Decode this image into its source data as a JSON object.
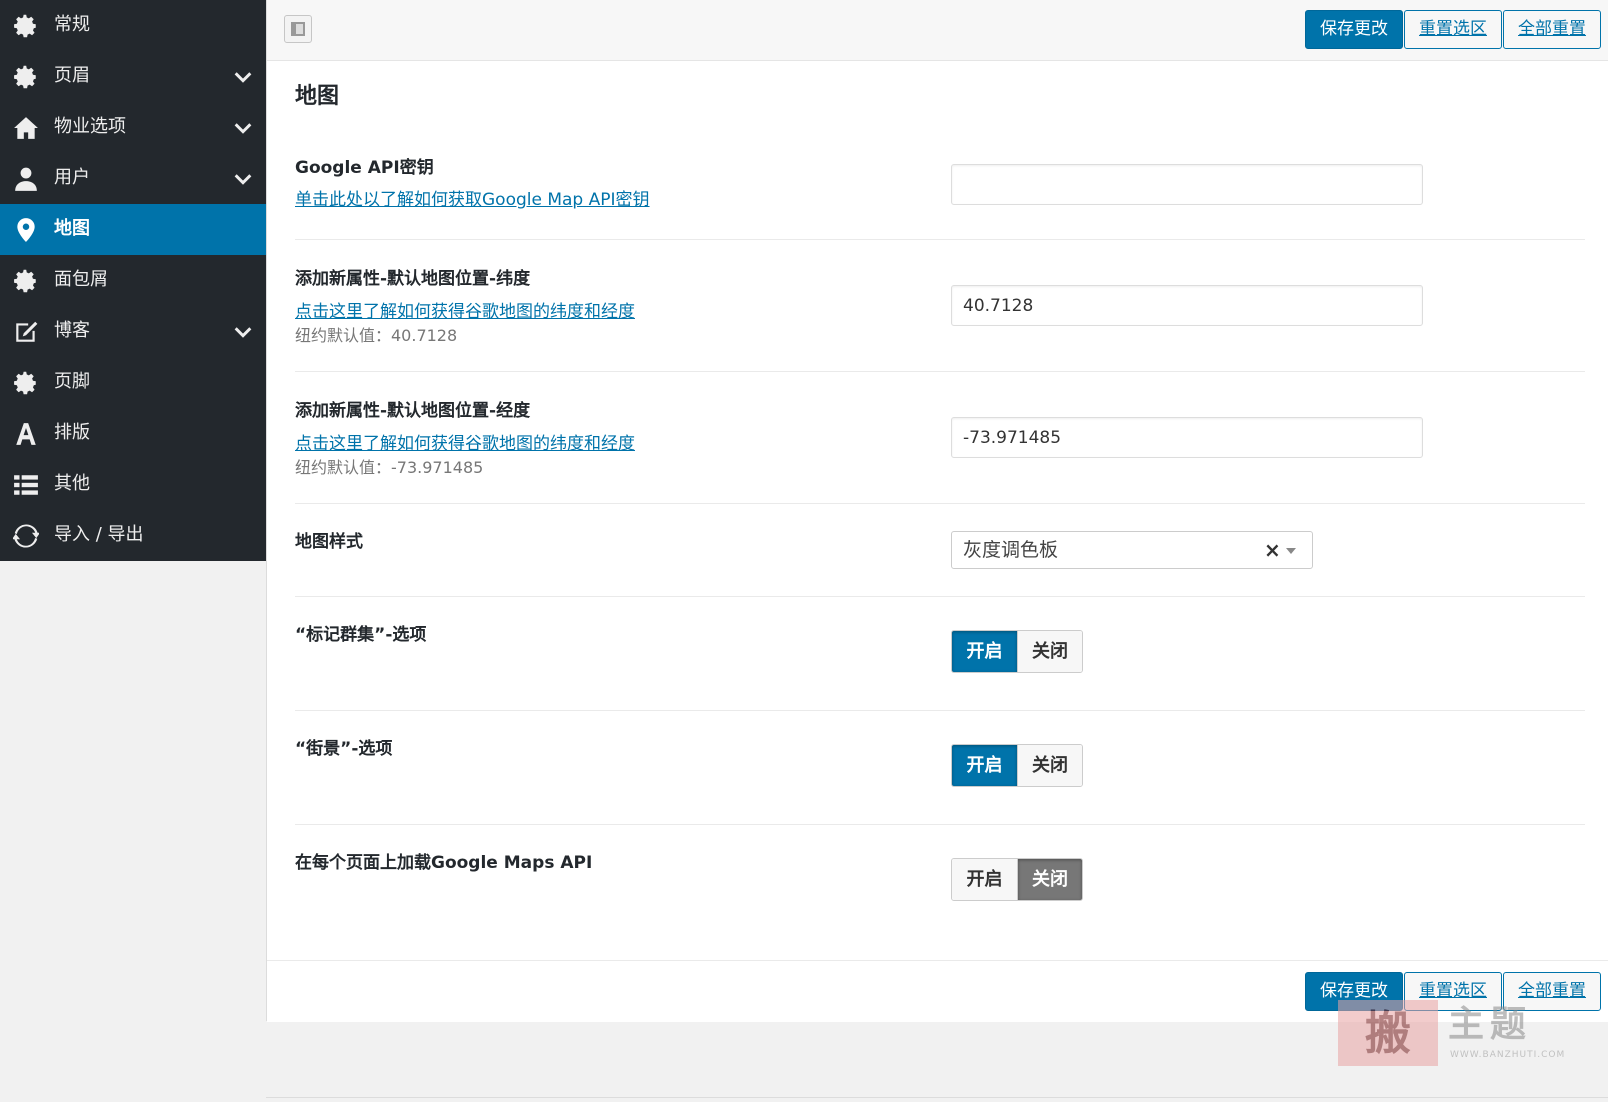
{
  "sidebar": {
    "items": [
      {
        "label": "常规",
        "icon": "gear-icon"
      },
      {
        "label": "页眉",
        "icon": "gear-icon",
        "has_children": true
      },
      {
        "label": "物业选项",
        "icon": "home-icon",
        "has_children": true
      },
      {
        "label": "用户",
        "icon": "user-icon",
        "has_children": true
      },
      {
        "label": "地图",
        "icon": "map-pin-icon",
        "active": true
      },
      {
        "label": "面包屑",
        "icon": "gear-icon"
      },
      {
        "label": "博客",
        "icon": "edit-icon",
        "has_children": true
      },
      {
        "label": "页脚",
        "icon": "gear-icon"
      },
      {
        "label": "排版",
        "icon": "font-icon"
      },
      {
        "label": "其他",
        "icon": "list-icon"
      },
      {
        "label": "导入 / 导出",
        "icon": "refresh-icon"
      }
    ]
  },
  "toolbar": {
    "save_label": "保存更改",
    "reset_section_label": "重置选区",
    "reset_all_label": "全部重置"
  },
  "section": {
    "title": "地图"
  },
  "fields": {
    "api_key": {
      "label": "Google API密钥",
      "link": "单击此处以了解如何获取Google Map API密钥",
      "value": ""
    },
    "latitude": {
      "label": "添加新属性-默认地图位置-纬度",
      "link": "点击这里了解如何获得谷歌地图的纬度和经度",
      "desc": "纽约默认值：40.7128",
      "value": "40.7128"
    },
    "longitude": {
      "label": "添加新属性-默认地图位置-经度",
      "link": "点击这里了解如何获得谷歌地图的纬度和经度",
      "desc": "纽约默认值：-73.971485",
      "value": "-73.971485"
    },
    "map_style": {
      "label": "地图样式",
      "selected": "灰度调色板",
      "clear": "×"
    },
    "marker_cluster": {
      "label": "“标记群集”-选项",
      "on": "开启",
      "off": "关闭",
      "state": "on"
    },
    "street_view": {
      "label": "“街景”-选项",
      "on": "开启",
      "off": "关闭",
      "state": "on"
    },
    "load_api": {
      "label": "在每个页面上加载Google Maps API",
      "on": "开启",
      "off": "关闭",
      "state": "off"
    }
  },
  "colors": {
    "accent": "#0073aa",
    "sidebar_bg": "#23282d",
    "toggle_off_selected": "#777777"
  },
  "watermark": {
    "seal": "搬",
    "text": "主题",
    "url": "WWW.BANZHUTI.COM"
  }
}
